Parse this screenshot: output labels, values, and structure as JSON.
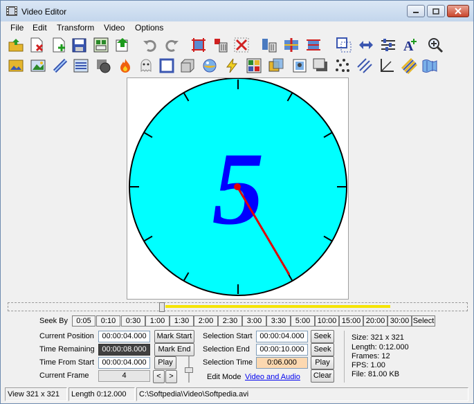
{
  "window": {
    "title": "Video Editor"
  },
  "menu": [
    "File",
    "Edit",
    "Transform",
    "Video",
    "Options"
  ],
  "toolbar1": [
    "open-icon",
    "close-file-icon",
    "add-file-icon",
    "save-icon",
    "save-frames-icon",
    "export-icon",
    "undo-icon",
    "redo-icon",
    "crop-frames-icon",
    "delete-frames-icon",
    "cancel-icon",
    "cut-icon",
    "split-icon",
    "trim-icon",
    "resize-icon",
    "flip-icon",
    "levels-icon",
    "text-icon",
    "zoom-icon"
  ],
  "toolbar2": [
    "insert-image-icon",
    "image-effect-icon",
    "sharpen-icon",
    "adjust-icon",
    "mask-icon",
    "fire-icon",
    "ghost-icon",
    "border-icon",
    "emboss-icon",
    "sphere-icon",
    "lightning-icon",
    "mosaic-icon",
    "blend-icon",
    "picture-icon",
    "shadow-icon",
    "noise-icon",
    "lines-icon",
    "angle-icon",
    "stripes-icon",
    "wave-icon"
  ],
  "preview": {
    "clock_digit": "5"
  },
  "seek": {
    "label": "Seek By",
    "buttons": [
      "0:05",
      "0:10",
      "0:30",
      "1:00",
      "1:30",
      "2:00",
      "2:30",
      "3:00",
      "3:30",
      "5:00",
      "10:00",
      "15:00",
      "20:00",
      "30:00",
      "Select"
    ]
  },
  "position": {
    "current_position_label": "Current Position",
    "current_position": "00:00:04.000",
    "time_remaining_label": "Time Remaining",
    "time_remaining": "00:00:08.000",
    "time_from_start_label": "Time From Start",
    "time_from_start": "00:00:04.000",
    "current_frame_label": "Current Frame",
    "current_frame": "4",
    "mark_start": "Mark Start",
    "mark_end": "Mark End",
    "play": "Play",
    "prev": "<",
    "next": ">"
  },
  "selection": {
    "start_label": "Selection Start",
    "start": "00:00:04.000",
    "end_label": "Selection End",
    "end": "00:00:10.000",
    "time_label": "Selection Time",
    "time": "0:06.000",
    "seek": "Seek",
    "seek2": "Seek",
    "play": "Play",
    "clear": "Clear",
    "edit_mode_label": "Edit Mode",
    "edit_mode": "Video and Audio"
  },
  "info": {
    "size": "Size:  321 x 321",
    "length": "Length:  0:12.000",
    "frames": "Frames:  12",
    "fps": "FPS:  1.00",
    "file": "File:  81.00 KB"
  },
  "timeline": {
    "position_fraction": 0.333
  },
  "status": {
    "view": "View 321 x 321",
    "length": "Length 0:12.000",
    "path": "C:\\Softpedia\\Video\\Softpedia.avi"
  }
}
